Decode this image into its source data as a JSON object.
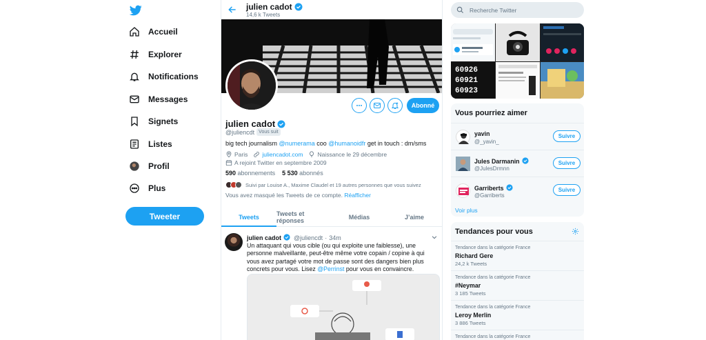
{
  "nav": {
    "items": [
      {
        "label": "Accueil",
        "icon": "home-icon"
      },
      {
        "label": "Explorer",
        "icon": "hashtag-icon"
      },
      {
        "label": "Notifications",
        "icon": "bell-icon"
      },
      {
        "label": "Messages",
        "icon": "envelope-icon"
      },
      {
        "label": "Signets",
        "icon": "bookmark-icon"
      },
      {
        "label": "Listes",
        "icon": "list-icon"
      },
      {
        "label": "Profil",
        "icon": "avatar-icon"
      },
      {
        "label": "Plus",
        "icon": "more-icon"
      }
    ],
    "tweet_button": "Tweeter"
  },
  "header": {
    "name": "julien cadot",
    "tweet_count": "14,6 k Tweets"
  },
  "profile": {
    "name": "julien cadot",
    "handle": "@juliencdt",
    "follows_you": "Vous suit",
    "bio_before": "big tech journalism ",
    "bio_link1": "@numerama",
    "bio_mid": " coo ",
    "bio_link2": "@humanoidfr",
    "bio_after": " get in touch : dm/sms",
    "location": "Paris",
    "website": "juliencadot.com",
    "birthday": "Naissance le 29 décembre",
    "joined": "A rejoint Twitter en septembre 2009",
    "following_count": "590",
    "following_label": "abonnements",
    "followers_count": "5 530",
    "followers_label": "abonnés",
    "followed_by": "Suivi par Louise A., Maxime Claudel et 19 autres personnes que vous suivez",
    "muted_text": "Vous avez masqué les Tweets de ce compte.",
    "muted_link": "Réafficher",
    "follow_button": "Abonné"
  },
  "tabs": [
    "Tweets",
    "Tweets et réponses",
    "Médias",
    "J’aime"
  ],
  "tweet": {
    "name": "julien cadot",
    "handle": "@juliencdt",
    "time": "34m",
    "text": "Un attaquant qui vous cible (ou qui exploite une faiblesse), une personne malveillante, peut-être même votre copain / copine à qui vous avez partagé votre mot de passe sont des dangers bien plus concrets pour vous. Lisez ",
    "link": "@Perrinst",
    "text_end": " pour vous en convaincre."
  },
  "search": {
    "placeholder": "Recherche Twitter"
  },
  "media_grid": {
    "numbers": [
      "60926",
      "60921",
      "60923"
    ]
  },
  "suggestions": {
    "title": "Vous pourriez aimer",
    "items": [
      {
        "name": "yavin",
        "handle": "@_yavin_",
        "verified": false,
        "button": "Suivre"
      },
      {
        "name": "Jules Darmanin",
        "handle": "@JulesDrmnn",
        "verified": true,
        "button": "Suivre"
      },
      {
        "name": "Garriberts",
        "handle": "@Garriberts",
        "verified": true,
        "button": "Suivre"
      }
    ],
    "see_more": "Voir plus"
  },
  "trends": {
    "title": "Tendances pour vous",
    "items": [
      {
        "category": "Tendance dans la catégorie France",
        "name": "Richard Gere",
        "count": "24,2 k Tweets"
      },
      {
        "category": "Tendance dans la catégorie France",
        "name": "#Neymar",
        "count": "3 185 Tweets"
      },
      {
        "category": "Tendance dans la catégorie France",
        "name": "Leroy Merlin",
        "count": "3 886 Tweets"
      },
      {
        "category": "Tendance dans la catégorie France",
        "name": "",
        "count": ""
      }
    ]
  },
  "colors": {
    "accent": "#1da1f2",
    "text": "#14171a",
    "secondary": "#657786"
  }
}
